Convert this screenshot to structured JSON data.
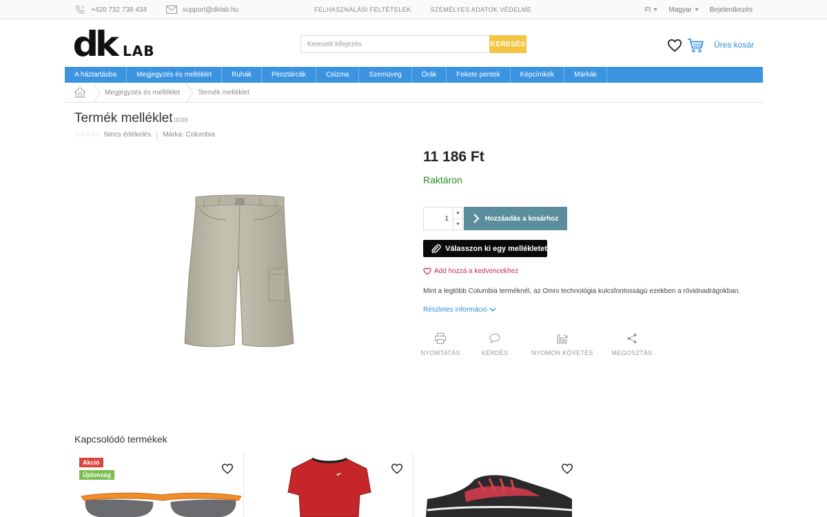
{
  "topbar": {
    "phone": "+420 732 738 434",
    "email": "support@dklab.hu",
    "links": [
      "FELHASZNÁLÁSI FELTÉTELEK",
      "SZEMÉLYES ADATOK VÉDELME"
    ],
    "currency": "Ft",
    "language": "Magyar",
    "login": "Bejelentkezés"
  },
  "header": {
    "logo_main": "dk",
    "logo_sub": "LAB",
    "search_placeholder": "Keresett kifejezés",
    "search_button": "KERESÉS",
    "cart_label": "Üres kosár"
  },
  "nav": {
    "items": [
      "A háztartásba",
      "Megjegyzés és melléklet",
      "Ruhák",
      "Pénztárcák",
      "Csizma",
      "Szemüveg",
      "Órák",
      "Fekete péntek",
      "Képcímkék",
      "Márkák"
    ]
  },
  "breadcrumb": [
    "Megjegyzés és melléklet",
    "Termék melléklet"
  ],
  "product": {
    "title": "Termék melléklet",
    "sku": "0038",
    "stars": "☆☆☆☆☆",
    "rating_text": "Nincs értékelés",
    "brand": "Márka: Columbia",
    "price": "11 186 Ft",
    "availability": "Raktáron",
    "quantity": "1",
    "add_to_cart": "Hozzáadás a kosárhoz",
    "choose_attachment": "Válasszon ki egy mellékletet",
    "add_favourite": "Add hozzá a kedvencekhez",
    "description": "Mint a legtöbb Columbia terméknél, az Omni technológia kulcsfontosságú ezekben a rövidnadrágokban.",
    "more_info": "Részletes információ",
    "actions": [
      "NYOMTATÁS",
      "KÉRDÉS",
      "NYOMON KÖVETÉS",
      "MEGOSZTÁS"
    ]
  },
  "related": {
    "title": "Kapcsolódó termékek",
    "badges": {
      "sale": "Akció",
      "new": "Újdonság"
    }
  },
  "colors": {
    "nav_blue": "#3c94e0",
    "search_yellow": "#f5c542",
    "add_cart_teal": "#5b8e9c",
    "stock_green": "#2a8a1f",
    "favourite_pink": "#c0285e",
    "link_blue": "#2e8fd8"
  }
}
